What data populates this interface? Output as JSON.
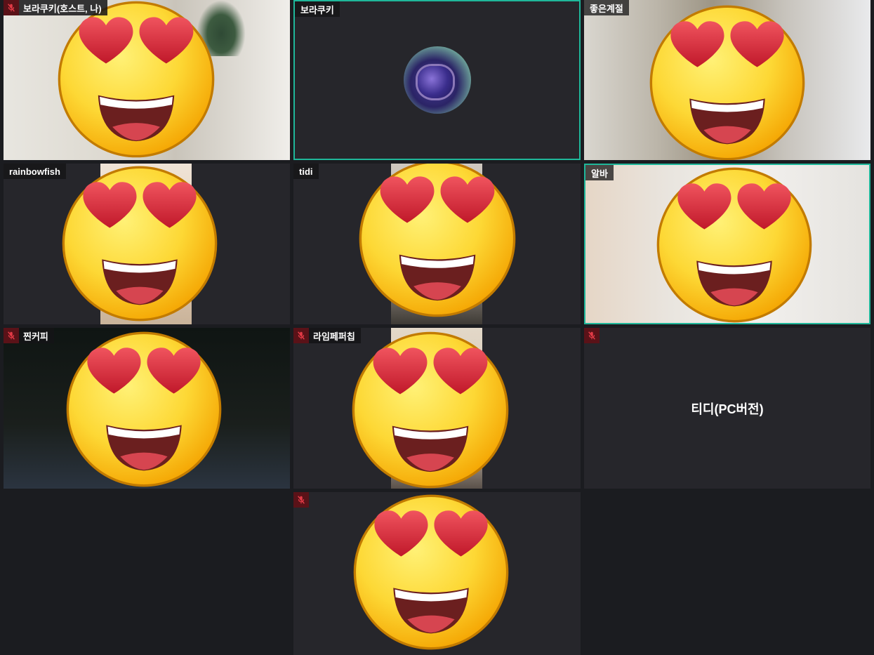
{
  "tiles": [
    {
      "id": "t1",
      "name": "보라쿠키(호스트, 나)",
      "muted": true
    },
    {
      "id": "t2",
      "name": "보라쿠키",
      "muted": false
    },
    {
      "id": "t3",
      "name": "좋은계절",
      "muted": false
    },
    {
      "id": "t4",
      "name": "rainbowfish",
      "muted": false
    },
    {
      "id": "t5",
      "name": "tidi",
      "muted": false
    },
    {
      "id": "t6",
      "name": "알바",
      "muted": false
    },
    {
      "id": "t7",
      "name": "찐커피",
      "muted": true
    },
    {
      "id": "t8",
      "name": "라임페퍼칩",
      "muted": true
    },
    {
      "id": "t9",
      "name": "",
      "muted": true,
      "center_label": "티디(PC버전)"
    },
    {
      "id": "t10",
      "name": "",
      "muted": true
    }
  ],
  "colors": {
    "active_border": "#1fb79a",
    "muted_bg": "#5a1218",
    "tile_bg": "#26262b",
    "page_bg": "#1b1c20"
  },
  "icons": {
    "mic": "mic-off-icon",
    "overlay": "heart-eyes-emoji-icon"
  }
}
